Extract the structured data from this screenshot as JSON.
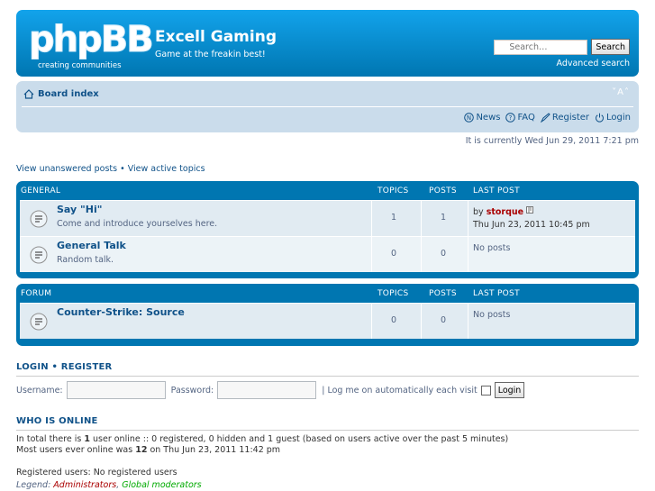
{
  "header": {
    "logo_word": "phpBB",
    "logo_tagline": "creating  communities",
    "site_title": "Excell Gaming",
    "site_description": "Game at the freakin best!",
    "search_placeholder": "Search…",
    "search_button": "Search",
    "advanced_search": "Advanced search"
  },
  "navbar": {
    "board_index": "Board index",
    "font_size_control": "A",
    "links": [
      "News",
      "FAQ",
      "Register",
      "Login"
    ]
  },
  "current_time": "It is currently Wed Jun 29, 2011 7:21 pm",
  "search_links": "View unanswered posts • View active topics",
  "columns": {
    "topics": "TOPICS",
    "posts": "POSTS",
    "last_post": "LAST POST"
  },
  "categories": [
    {
      "name": "GENERAL",
      "forums": [
        {
          "title": "Say \"Hi\"",
          "description": "Come and introduce yourselves here.",
          "topics": "1",
          "posts": "1",
          "last_by": "by",
          "last_user": "storque",
          "last_date": "Thu Jun 23, 2011 10:45 pm"
        },
        {
          "title": "General Talk",
          "description": "Random talk.",
          "topics": "0",
          "posts": "0",
          "no_posts": "No posts"
        }
      ]
    },
    {
      "name": "FORUM",
      "forums": [
        {
          "title": "Counter-Strike: Source",
          "description": "",
          "topics": "0",
          "posts": "0",
          "no_posts": "No posts"
        }
      ]
    }
  ],
  "login": {
    "heading_login": "LOGIN",
    "heading_sep": "•",
    "heading_register": "REGISTER",
    "username_label": "Username:",
    "password_label": "Password:",
    "autologin_label": "| Log me on automatically each visit",
    "login_button": "Login"
  },
  "online": {
    "heading": "WHO IS ONLINE",
    "line1_pre": "In total there is ",
    "line1_count": "1",
    "line1_post": " user online :: 0 registered, 0 hidden and 1 guest (based on users active over the past 5 minutes)",
    "line2_pre": "Most users ever online was ",
    "line2_count": "12",
    "line2_post": " on Thu Jun 23, 2011 11:42 pm",
    "registered": "Registered users: No registered users",
    "legend_label": "Legend: ",
    "legend_admin": "Administrators",
    "legend_sep": ", ",
    "legend_gmod": "Global moderators"
  },
  "colors": {
    "header_blue": "#0076b1",
    "link_blue": "#105289",
    "navbar_bg": "#cadceb",
    "admin_red": "#aa0000",
    "gmod_green": "#00aa00"
  }
}
